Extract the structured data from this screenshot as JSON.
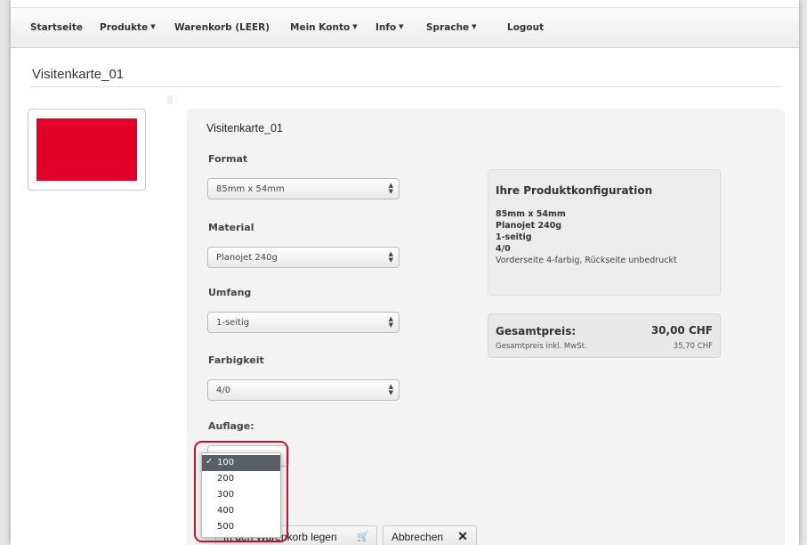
{
  "nav": {
    "items": [
      {
        "label": "Startseite",
        "has_caret": false
      },
      {
        "label": "Produkte",
        "has_caret": true
      },
      {
        "label": "Warenkorb (LEER)",
        "has_caret": false
      },
      {
        "label": "Mein Konto",
        "has_caret": true
      },
      {
        "label": "Info",
        "has_caret": true
      },
      {
        "label": "Sprache",
        "has_caret": true
      },
      {
        "label": "Logout",
        "has_caret": false
      }
    ]
  },
  "page_title": "Visitenkarte_01",
  "thumbnail": {
    "color": "#e2002b"
  },
  "product": {
    "name": "Visitenkarte_01",
    "fields": [
      {
        "label": "Format",
        "value": "85mm x 54mm"
      },
      {
        "label": "Material",
        "value": "Planojet 240g"
      },
      {
        "label": "Umfang",
        "value": "1-seitig"
      },
      {
        "label": "Farbigkeit",
        "value": "4/0"
      }
    ],
    "quantity_label": "Auflage:",
    "quantity_options": [
      "100",
      "200",
      "300",
      "400",
      "500"
    ],
    "quantity_selected": "100",
    "check_mark": "✓"
  },
  "summary": {
    "title": "Ihre Produktkonfiguration",
    "format": "85mm x 54mm",
    "material": "Planojet 240g",
    "umfang": "1-seitig",
    "farbigkeit": "4/0",
    "description": "Vorderseite 4-farbig, Rückseite unbedruckt"
  },
  "price": {
    "label": "Gesamtpreis:",
    "value": "30,00 CHF",
    "incl_label": "Gesamtpreis inkl. MwSt.",
    "incl_value": "35,70 CHF"
  },
  "buttons": {
    "cart": "In den Warenkorb legen",
    "cart_icon": "cart-icon",
    "cancel": "Abbrechen",
    "cancel_icon": "close-icon"
  },
  "colors": {
    "highlight": "#c8102e",
    "selected_option": "#5a5e66"
  }
}
